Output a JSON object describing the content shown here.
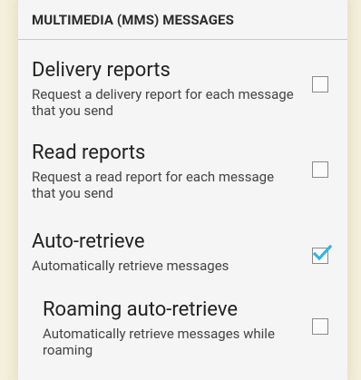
{
  "section": {
    "header": "MULTIMEDIA (MMS) MESSAGES"
  },
  "items": [
    {
      "title": "Delivery reports",
      "summary": "Request a delivery report for each message that you send",
      "checked": false
    },
    {
      "title": "Read reports",
      "summary": "Request a read report for each message that you send",
      "checked": false
    },
    {
      "title": "Auto-retrieve",
      "summary": "Automatically retrieve messages",
      "checked": true
    },
    {
      "title": "Roaming auto-retrieve",
      "summary": "Automatically retrieve messages while roaming",
      "checked": false
    }
  ],
  "colors": {
    "checkmark": "#33b5e5",
    "background": "#f5f0dc",
    "panel": "#f5f5f5"
  },
  "icons": {
    "checked": "checkmark-icon"
  }
}
